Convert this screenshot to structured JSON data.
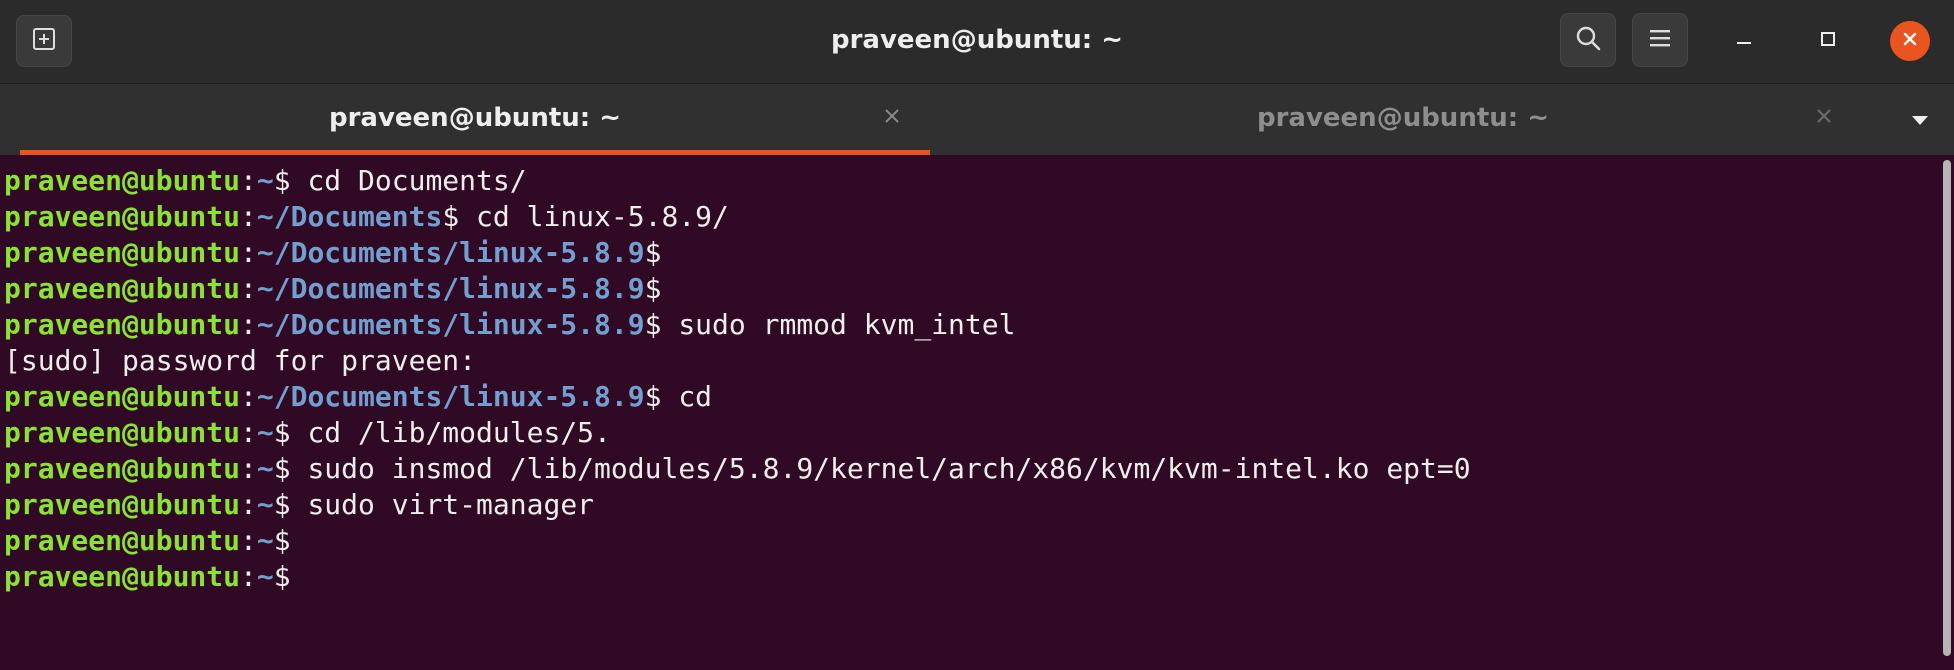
{
  "window": {
    "title": "praveen@ubuntu: ~",
    "accent_color": "#e9541f",
    "buttons": {
      "new_tab": "new-tab-icon",
      "search": "search-icon",
      "menu": "hamburger-menu-icon",
      "minimize": "minimize-icon",
      "maximize": "maximize-icon",
      "close": "close-icon"
    }
  },
  "tabs": [
    {
      "label": "praveen@ubuntu: ~",
      "active": true
    },
    {
      "label": "praveen@ubuntu: ~",
      "active": false
    }
  ],
  "terminal": {
    "colors": {
      "background": "#300a24",
      "user_host": "#8ae234",
      "path": "#729fcf",
      "text": "#eeeeec"
    },
    "lines": [
      {
        "user": "praveen@ubuntu",
        "sep": ":",
        "path": "~",
        "prompt": "$",
        "cmd": " cd Documents/"
      },
      {
        "user": "praveen@ubuntu",
        "sep": ":",
        "path": "~/Documents",
        "prompt": "$",
        "cmd": " cd linux-5.8.9/"
      },
      {
        "user": "praveen@ubuntu",
        "sep": ":",
        "path": "~/Documents/linux-5.8.9",
        "prompt": "$",
        "cmd": ""
      },
      {
        "user": "praveen@ubuntu",
        "sep": ":",
        "path": "~/Documents/linux-5.8.9",
        "prompt": "$",
        "cmd": ""
      },
      {
        "user": "praveen@ubuntu",
        "sep": ":",
        "path": "~/Documents/linux-5.8.9",
        "prompt": "$",
        "cmd": " sudo rmmod kvm_intel"
      },
      {
        "output": "[sudo] password for praveen:"
      },
      {
        "user": "praveen@ubuntu",
        "sep": ":",
        "path": "~/Documents/linux-5.8.9",
        "prompt": "$",
        "cmd": " cd"
      },
      {
        "user": "praveen@ubuntu",
        "sep": ":",
        "path": "~",
        "prompt": "$",
        "cmd": " cd /lib/modules/5."
      },
      {
        "user": "praveen@ubuntu",
        "sep": ":",
        "path": "~",
        "prompt": "$",
        "cmd": " sudo insmod /lib/modules/5.8.9/kernel/arch/x86/kvm/kvm-intel.ko ept=0"
      },
      {
        "user": "praveen@ubuntu",
        "sep": ":",
        "path": "~",
        "prompt": "$",
        "cmd": " sudo virt-manager"
      },
      {
        "user": "praveen@ubuntu",
        "sep": ":",
        "path": "~",
        "prompt": "$",
        "cmd": ""
      },
      {
        "user": "praveen@ubuntu",
        "sep": ":",
        "path": "~",
        "prompt": "$",
        "cmd": ""
      }
    ]
  }
}
